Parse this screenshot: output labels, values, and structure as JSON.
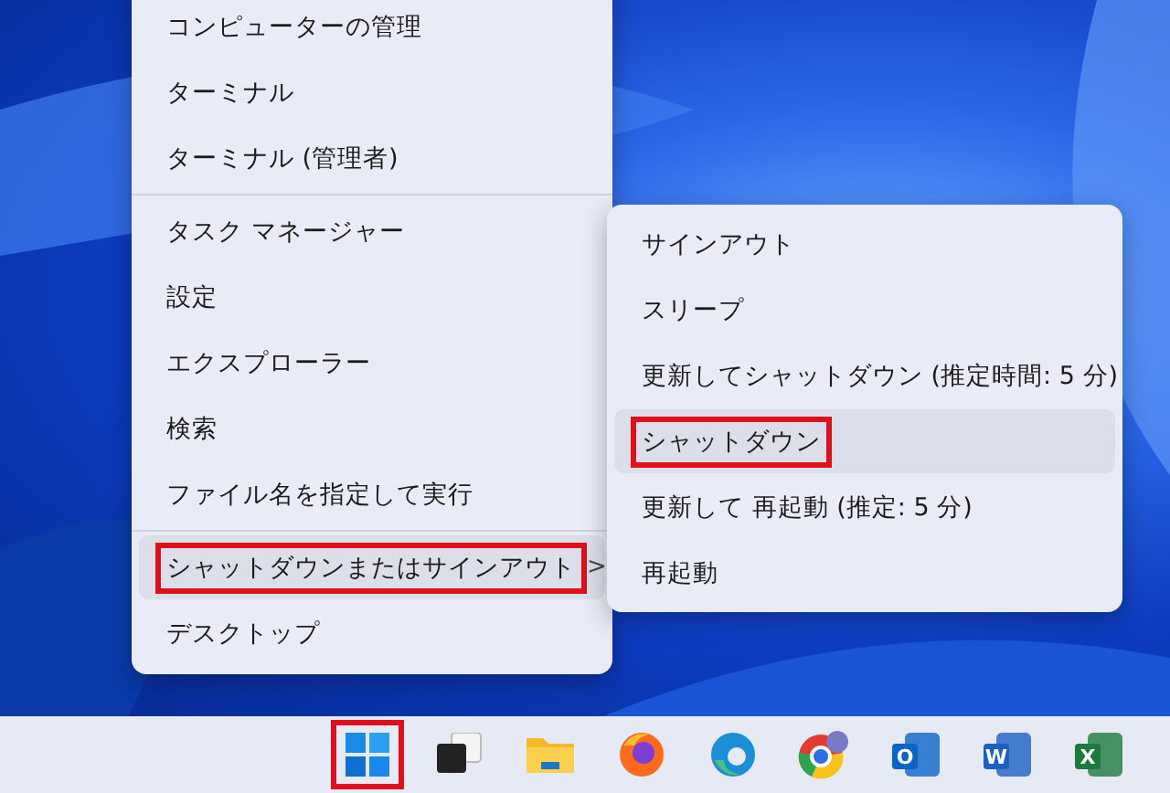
{
  "context_menu": {
    "groups": [
      [
        {
          "label": "コンピューターの管理",
          "highlighted": false,
          "outlined": false
        },
        {
          "label": "ターミナル",
          "highlighted": false,
          "outlined": false
        },
        {
          "label": "ターミナル (管理者)",
          "highlighted": false,
          "outlined": false
        }
      ],
      [
        {
          "label": "タスク マネージャー",
          "highlighted": false,
          "outlined": false
        },
        {
          "label": "設定",
          "highlighted": false,
          "outlined": false
        },
        {
          "label": "エクスプローラー",
          "highlighted": false,
          "outlined": false
        },
        {
          "label": "検索",
          "highlighted": false,
          "outlined": false
        },
        {
          "label": "ファイル名を指定して実行",
          "highlighted": false,
          "outlined": false
        }
      ],
      [
        {
          "label": "シャットダウンまたはサインアウト",
          "highlighted": true,
          "outlined": true,
          "chevron": ">"
        },
        {
          "label": "デスクトップ",
          "highlighted": false,
          "outlined": false
        }
      ]
    ]
  },
  "submenu": {
    "items": [
      {
        "label": "サインアウト",
        "highlighted": false,
        "outlined": false
      },
      {
        "label": "スリープ",
        "highlighted": false,
        "outlined": false
      },
      {
        "label": "更新してシャットダウン (推定時間: 5 分)",
        "highlighted": false,
        "outlined": false
      },
      {
        "label": "シャットダウン",
        "highlighted": true,
        "outlined": true
      },
      {
        "label": "更新して 再起動 (推定: 5 分)",
        "highlighted": false,
        "outlined": false
      },
      {
        "label": "再起動",
        "highlighted": false,
        "outlined": false
      }
    ]
  },
  "taskbar": {
    "icons": [
      {
        "kind": "start",
        "outlined": true
      },
      {
        "kind": "task-view",
        "outlined": false
      },
      {
        "kind": "folder",
        "outlined": false
      },
      {
        "kind": "firefox",
        "outlined": false
      },
      {
        "kind": "edge",
        "outlined": false
      },
      {
        "kind": "chrome",
        "outlined": false
      },
      {
        "kind": "office",
        "letter": "O",
        "color": "#0a64c8",
        "outlined": false
      },
      {
        "kind": "office",
        "letter": "W",
        "color": "#1a5fc4",
        "outlined": false
      },
      {
        "kind": "office",
        "letter": "X",
        "color": "#1b7a3e",
        "outlined": false
      }
    ]
  }
}
